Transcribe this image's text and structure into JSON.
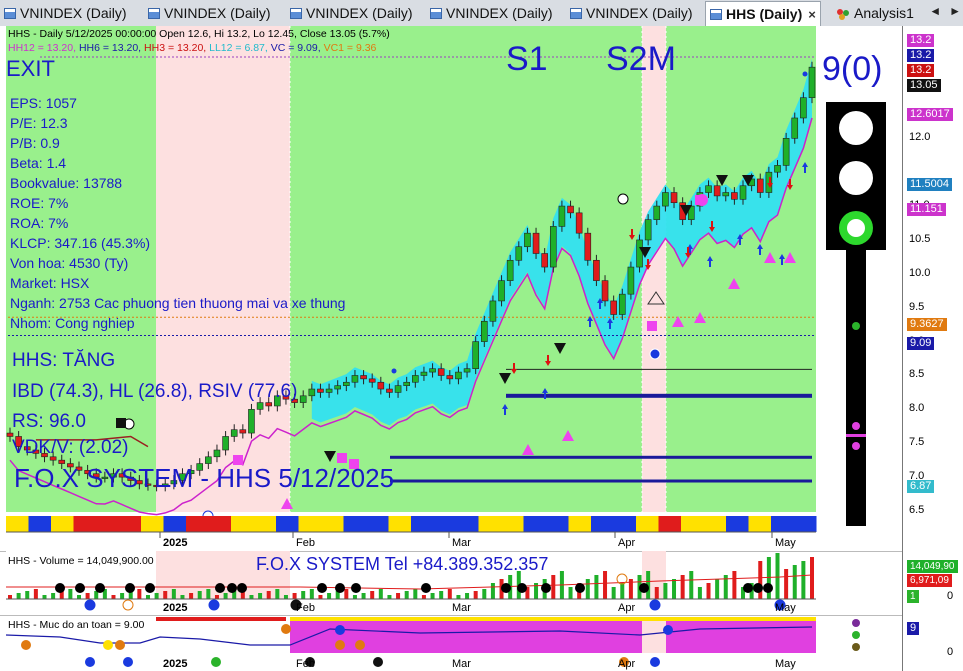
{
  "tabs": [
    {
      "label": "VNINDEX (Daily)"
    },
    {
      "label": "VNINDEX (Daily)"
    },
    {
      "label": "VNINDEX (Daily)"
    },
    {
      "label": "VNINDEX (Daily)"
    },
    {
      "label": "VNINDEX (Daily)"
    },
    {
      "label": "HHS (Daily)"
    },
    {
      "label": "Analysis1"
    }
  ],
  "tab_close": "×",
  "tab_nav": {
    "left": "◄",
    "right": "►"
  },
  "header": {
    "line1": "HHS - Daily 5/12/2025 00:00:00 Open 12.6, Hi 13.2, Lo 12.45, Close 13.05 (5.7%)",
    "hh12": "HH12 = 13.20,",
    "hh6": "HH6 = 13.20,",
    "hh3": "HH3 = 13.20,",
    "ll12": "LL12 = 6.87,",
    "vc": "VC = 9.09,",
    "vc1": "VC1 = 9.36"
  },
  "overlay": {
    "exit": "EXIT",
    "s1": "S1",
    "s2m": "S2M",
    "signal": "9(0)",
    "fundamentals": [
      "EPS: 1057",
      "P/E: 12.3",
      "P/B: 0.9",
      "Beta: 1.4",
      "Bookvalue: 13788",
      "ROE: 7%",
      "ROA: 7%",
      "KLCP: 347.16 (45.3%)",
      "Von hoa: 4530 (Ty)",
      "Market: HSX",
      "Nganh: 2753 Cac phuong tien thuong mai va xe thung",
      "Nhom: Cong nghiep"
    ],
    "trend": "HHS: TĂNG",
    "ibd": "IBD (74.3), HL (26.8), RSIV (77.6)",
    "rs": "RS: 96.0",
    "vdk": "VDK/V:  (2.02)",
    "title": "F.O.X SYSTEM - HHS 5/12/2025"
  },
  "price_axis": {
    "ticks": [
      "12.0",
      "11.0",
      "10.5",
      "10.0",
      "9.5",
      "9.0",
      "8.5",
      "8.0",
      "7.5",
      "7.0",
      "6.5"
    ],
    "boxes": [
      {
        "text": "13.2",
        "color": "#cc33cc"
      },
      {
        "text": "13.2",
        "color": "#1a1aa8"
      },
      {
        "text": "13.2",
        "color": "#cc1111"
      },
      {
        "text": "13.05",
        "color": "#111111"
      },
      {
        "text": "12.6017",
        "color": "#cc33cc"
      },
      {
        "text": "11.5004",
        "color": "#2080c0"
      },
      {
        "text": "11.151",
        "color": "#cc33cc"
      },
      {
        "text": "9.3627",
        "color": "#e07a10"
      },
      {
        "text": "9.09",
        "color": "#1a1aa8"
      },
      {
        "text": "6.87",
        "color": "#33bbcc"
      }
    ]
  },
  "months": [
    "2025",
    "Feb",
    "Mar",
    "Apr",
    "May"
  ],
  "volume": {
    "header": "HHS - Volume = 14,049,900.00",
    "tel": "F.O.X SYSTEM Tel +84.389.352.357",
    "box1": "14,049,90",
    "box2": "6,971,09",
    "box3": "1",
    "zero": "0"
  },
  "safety": {
    "header": "HHS - Muc do an toan = 9.00",
    "box": "9",
    "zero": "0"
  },
  "chart_data": {
    "type": "candlestick",
    "title": "HHS - Daily 5/12/2025",
    "last": {
      "open": 12.6,
      "high": 13.2,
      "low": 12.45,
      "close": 13.05,
      "change_pct": 5.7
    },
    "ylim": [
      6.3,
      13.4
    ],
    "ylabel": "",
    "series": [
      {
        "name": "HHS",
        "values": [
          7.6,
          7.45,
          7.4,
          7.35,
          7.3,
          7.25,
          7.2,
          7.15,
          7.1,
          7.05,
          7.0,
          7.0,
          7.05,
          7.0,
          6.95,
          6.9,
          6.88,
          6.87,
          6.9,
          6.95,
          7.05,
          7.1,
          7.2,
          7.3,
          7.4,
          7.6,
          7.7,
          7.65,
          8.0,
          8.1,
          8.05,
          8.2,
          8.15,
          8.1,
          8.2,
          8.3,
          8.25,
          8.3,
          8.35,
          8.4,
          8.5,
          8.45,
          8.4,
          8.3,
          8.25,
          8.35,
          8.4,
          8.5,
          8.55,
          8.6,
          8.5,
          8.45,
          8.55,
          8.6,
          9.0,
          9.3,
          9.6,
          9.9,
          10.2,
          10.4,
          10.6,
          10.3,
          10.1,
          10.7,
          11.0,
          10.9,
          10.6,
          10.2,
          9.9,
          9.6,
          9.4,
          9.7,
          10.1,
          10.5,
          10.8,
          11.0,
          11.2,
          11.05,
          10.8,
          11.0,
          11.2,
          11.3,
          11.15,
          11.2,
          11.1,
          11.3,
          11.4,
          11.2,
          11.5,
          11.6,
          12.0,
          12.3,
          12.6,
          13.05
        ]
      }
    ]
  },
  "legend_colors": {
    "bg_green": "#99f08c",
    "bg_pink": "#fde0e0",
    "band": "#33e0f0",
    "candle_up": "#1fb02a",
    "candle_down": "#e01c1c",
    "magenta": "#e040e0"
  }
}
